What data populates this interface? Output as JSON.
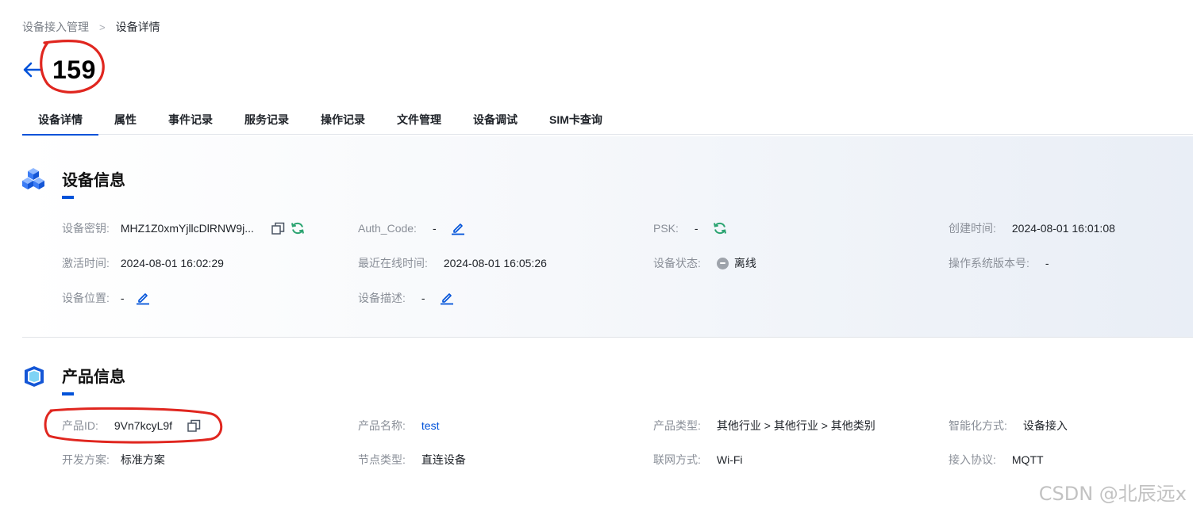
{
  "breadcrumb": {
    "parent": "设备接入管理",
    "separator": ">",
    "current": "设备详情"
  },
  "header": {
    "title": "159",
    "back_icon": "arrow-left-icon"
  },
  "tabs": [
    {
      "label": "设备详情",
      "active": true
    },
    {
      "label": "属性"
    },
    {
      "label": "事件记录"
    },
    {
      "label": "服务记录"
    },
    {
      "label": "操作记录"
    },
    {
      "label": "文件管理"
    },
    {
      "label": "设备调试"
    },
    {
      "label": "SIM卡查询"
    }
  ],
  "device_info": {
    "title": "设备信息",
    "key_label": "设备密钥:",
    "key_value": "MHZ1Z0xmYjllcDlRNW9j...",
    "auth_label": "Auth_Code:",
    "auth_value": "-",
    "psk_label": "PSK:",
    "psk_value": "-",
    "created_label": "创建时间:",
    "created_value": "2024-08-01 16:01:08",
    "activated_label": "激活时间:",
    "activated_value": "2024-08-01 16:02:29",
    "last_online_label": "最近在线时间:",
    "last_online_value": "2024-08-01 16:05:26",
    "status_label": "设备状态:",
    "status_value": "离线",
    "os_label": "操作系统版本号:",
    "os_value": "-",
    "location_label": "设备位置:",
    "location_value": "-",
    "desc_label": "设备描述:",
    "desc_value": "-"
  },
  "product_info": {
    "title": "产品信息",
    "id_label": "产品ID:",
    "id_value": "9Vn7kcyL9f",
    "name_label": "产品名称:",
    "name_value": "test",
    "type_label": "产品类型:",
    "type_value": "其他行业 > 其他行业 > 其他类别",
    "smart_label": "智能化方式:",
    "smart_value": "设备接入",
    "scheme_label": "开发方案:",
    "scheme_value": "标准方案",
    "node_label": "节点类型:",
    "node_value": "直连设备",
    "network_label": "联网方式:",
    "network_value": "Wi-Fi",
    "protocol_label": "接入协议:",
    "protocol_value": "MQTT"
  },
  "watermark": "CSDN @北辰远x",
  "colors": {
    "accent": "#0052d9",
    "refresh": "#2ba471",
    "status_offline": "#9ea3ab",
    "annotation": "#e0261f"
  }
}
